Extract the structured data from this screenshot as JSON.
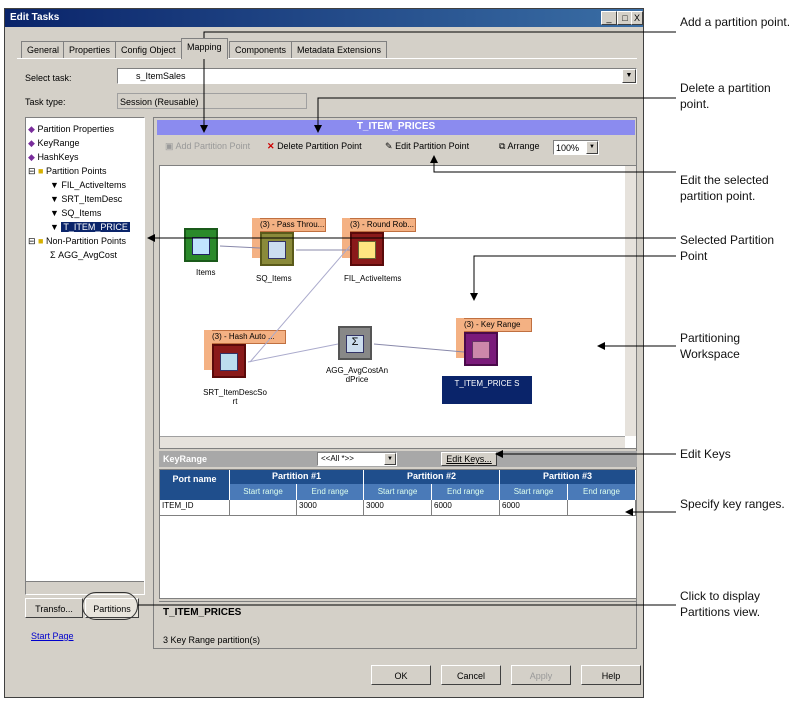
{
  "window": {
    "title": "Edit Tasks",
    "min": "_",
    "max": "□",
    "close": "X"
  },
  "tabs": [
    "General",
    "Properties",
    "Config Object",
    "Mapping",
    "Components",
    "Metadata Extensions"
  ],
  "select_task": {
    "label": "Select task:",
    "value": "s_ItemSales"
  },
  "task_type": {
    "label": "Task type:",
    "value": "Session (Reusable)"
  },
  "tree": {
    "items": [
      "Partition Properties",
      "KeyRange",
      "HashKeys",
      "Partition Points",
      "FIL_ActiveItems",
      "SRT_ItemDesc",
      "SQ_Items",
      "T_ITEM_PRICE",
      "Non-Partition Points",
      "AGG_AvgCost"
    ]
  },
  "left_tabs": {
    "transform": "Transfo...",
    "partitions": "Partitions"
  },
  "start_page": "Start Page",
  "workspace": {
    "header": "T_ITEM_PRICES",
    "toolbar": {
      "add": "Add Partition Point",
      "delete": "Delete Partition Point",
      "edit": "Edit Partition Point",
      "arrange": "Arrange",
      "zoom": "100%"
    },
    "nodes": {
      "items": "Items",
      "sq": "SQ_Items",
      "sq_lbl": "(3) - Pass Throu...",
      "fil": "FIL_ActiveItems",
      "fil_lbl": "(3) - Round Rob...",
      "srt": "SRT_ItemDescSo rt",
      "srt_lbl": "(3) - Hash Auto ...",
      "agg": "AGG_AvgCostAn dPrice",
      "target": "T_ITEM_PRICE S",
      "target_lbl": "(3) - Key Range"
    }
  },
  "keyrange": {
    "label": "KeyRange",
    "dropdown": "<<All *>>",
    "edit_keys": "Edit Keys...",
    "col_port": "Port name",
    "partitions": [
      "Partition #1",
      "Partition #2",
      "Partition #3"
    ],
    "start": "Start range",
    "end": "End range",
    "row": {
      "port": "ITEM_ID",
      "cells": [
        "",
        "3000",
        "3000",
        "6000",
        "6000",
        ""
      ]
    }
  },
  "bottom": {
    "title": "T_ITEM_PRICES",
    "status": "3 Key Range partition(s)"
  },
  "buttons": {
    "ok": "OK",
    "cancel": "Cancel",
    "apply": "Apply",
    "help": "Help"
  },
  "annotations": {
    "add": "Add a partition point.",
    "delete": "Delete a partition point.",
    "edit": "Edit the selected partition point.",
    "selected": "Selected Partition Point",
    "workspace": "Partitioning Workspace",
    "editkeys": "Edit Keys",
    "keyranges": "Specify key ranges.",
    "partview": "Click to display Partitions view."
  }
}
